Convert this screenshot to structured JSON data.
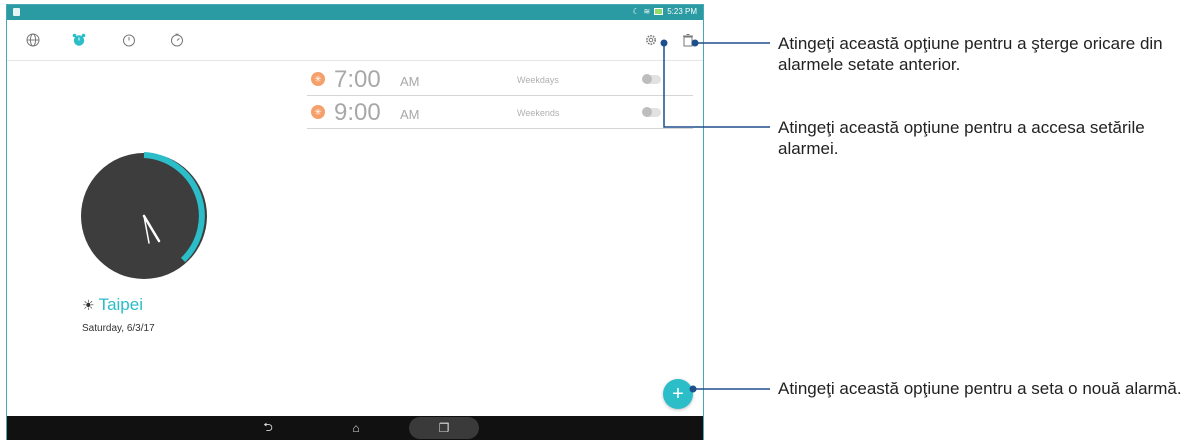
{
  "status_bar": {
    "time": "5:23 PM"
  },
  "toolbar": {
    "tabs": [
      {
        "name": "world-clock",
        "icon": "globe-icon"
      },
      {
        "name": "alarm",
        "icon": "alarm-clock-icon",
        "active": true
      },
      {
        "name": "stopwatch",
        "icon": "stopwatch-icon"
      },
      {
        "name": "timer",
        "icon": "timer-icon"
      }
    ],
    "settings_icon": "gear-icon",
    "delete_icon": "trash-icon"
  },
  "alarms": [
    {
      "time": "7:00",
      "ampm": "AM",
      "days": "Weekdays",
      "enabled": false
    },
    {
      "time": "9:00",
      "ampm": "AM",
      "days": "Weekends",
      "enabled": false
    }
  ],
  "clock": {
    "city": "Taipei",
    "date": "Saturday, 6/3/17"
  },
  "fab": {
    "label": "+"
  },
  "callouts": {
    "delete": "Atingeţi această opţiune pentru a şterge oricare din alarmele setate anterior.",
    "settings": "Atingeţi această opţiune pentru a accesa setările alarmei.",
    "add": "Atingeţi această opţiune pentru a seta o nouă alarmă."
  },
  "colors": {
    "accent": "#2bbdc8",
    "status_bar": "#2a9aa3",
    "alarm_icon": "#f5a06a",
    "callout_line": "#1d4f8c"
  }
}
